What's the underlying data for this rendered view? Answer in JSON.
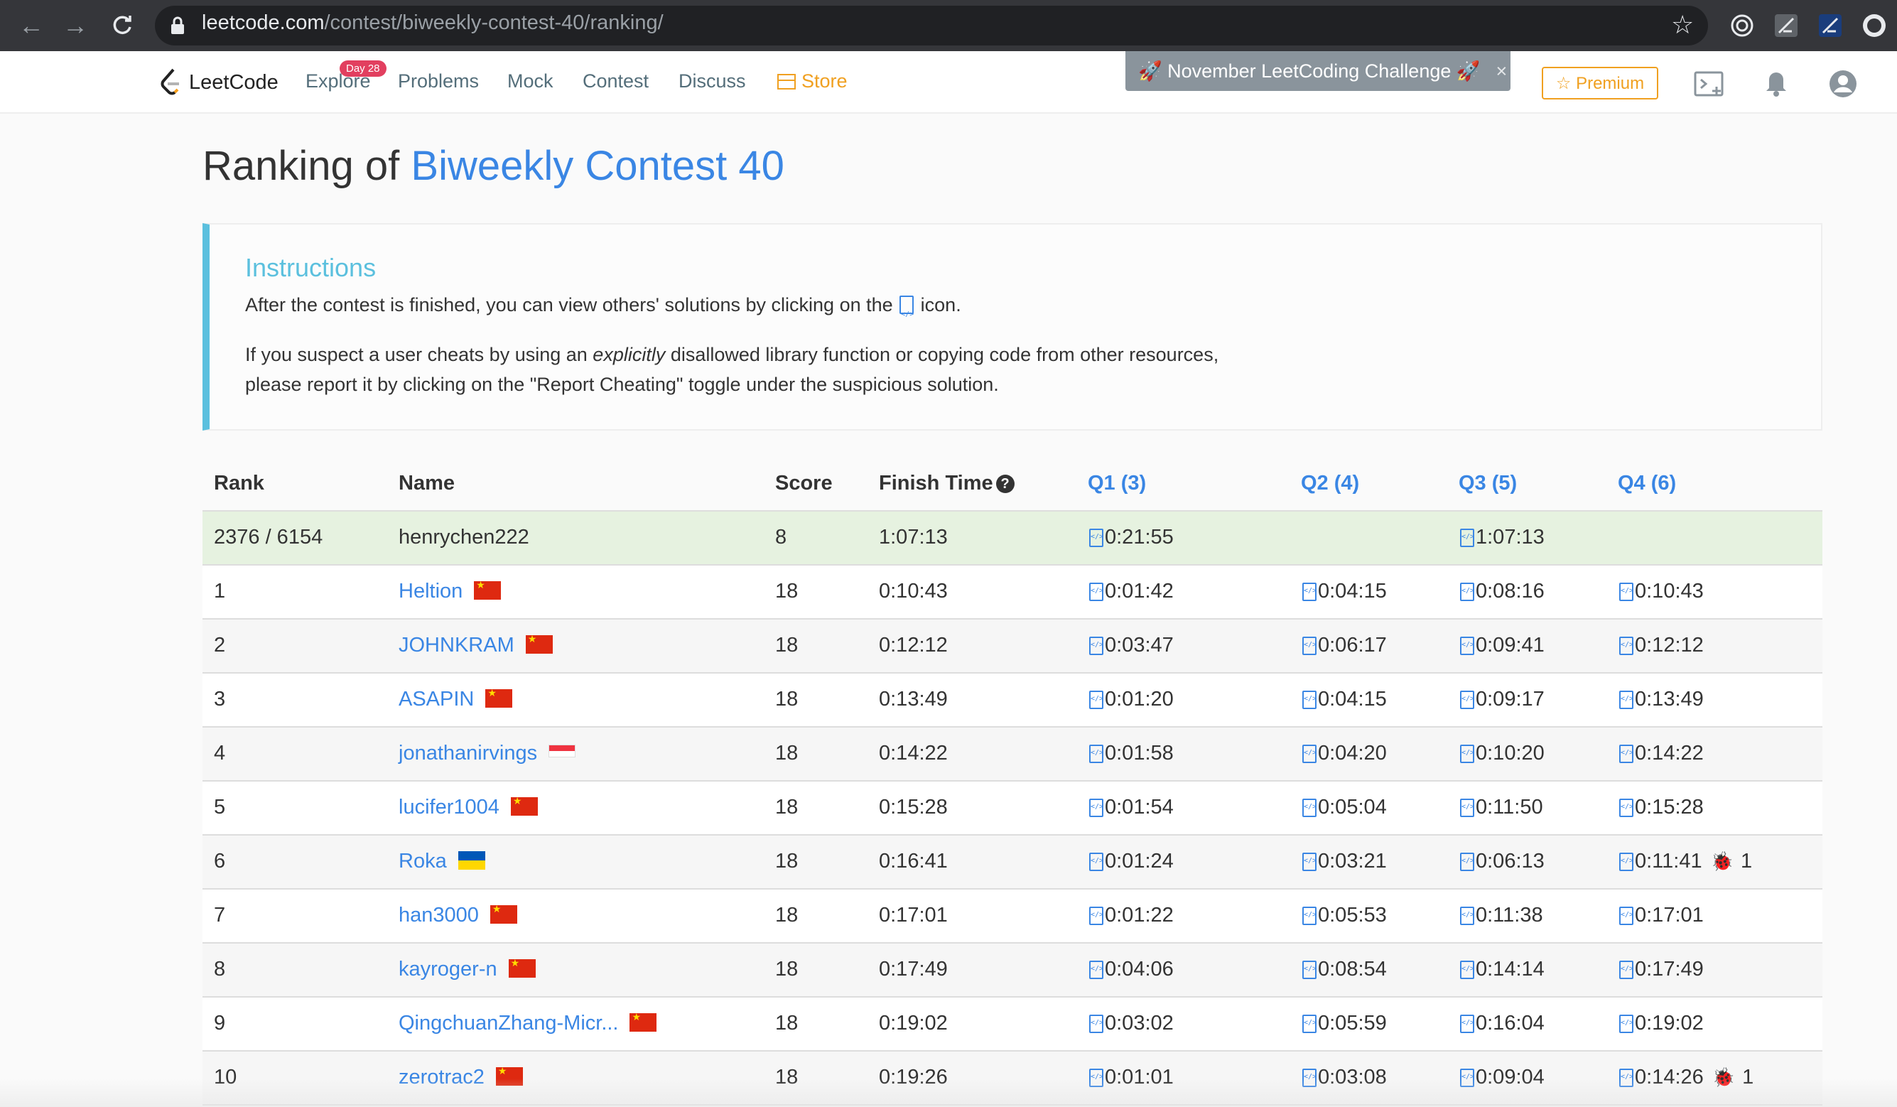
{
  "browser": {
    "url_host": "leetcode.com",
    "url_path": "/contest/biweekly-contest-40/ranking/"
  },
  "nav": {
    "brand": "LeetCode",
    "explore": "Explore",
    "explore_badge": "Day 28",
    "problems": "Problems",
    "mock": "Mock",
    "contest": "Contest",
    "discuss": "Discuss",
    "store": "Store",
    "challenge": "🚀 November LeetCoding Challenge 🚀",
    "challenge_close": "×",
    "premium": "☆ Premium"
  },
  "page": {
    "title_prefix": "Ranking of ",
    "title_contest": "Biweekly Contest 40"
  },
  "instructions": {
    "title": "Instructions",
    "line1_a": "After the contest is finished, you can view others' solutions by clicking on the",
    "line1_b": "icon.",
    "line2_a": "If you suspect a user cheats by using an ",
    "line2_em": "explicitly",
    "line2_b": " disallowed library function or copying code from other resources,",
    "line3": "please report it by clicking on the \"Report Cheating\" toggle under the suspicious solution."
  },
  "table": {
    "headers": {
      "rank": "Rank",
      "name": "Name",
      "score": "Score",
      "finish": "Finish Time",
      "q1": "Q1 (3)",
      "q2": "Q2 (4)",
      "q3": "Q3 (5)",
      "q4": "Q4 (6)"
    },
    "me": {
      "rank": "2376 / 6154",
      "name": "henrychen222",
      "score": "8",
      "finish": "1:07:13",
      "q1": "0:21:55",
      "q2": "",
      "q3": "1:07:13",
      "q4": ""
    },
    "rows": [
      {
        "rank": "1",
        "name": "Heltion",
        "flag": "cn",
        "score": "18",
        "finish": "0:10:43",
        "q1": "0:01:42",
        "q2": "0:04:15",
        "q3": "0:08:16",
        "q4": "0:10:43",
        "q4_bugs": ""
      },
      {
        "rank": "2",
        "name": "JOHNKRAM",
        "flag": "cn",
        "score": "18",
        "finish": "0:12:12",
        "q1": "0:03:47",
        "q2": "0:06:17",
        "q3": "0:09:41",
        "q4": "0:12:12",
        "q4_bugs": ""
      },
      {
        "rank": "3",
        "name": "ASAPIN",
        "flag": "cn",
        "score": "18",
        "finish": "0:13:49",
        "q1": "0:01:20",
        "q2": "0:04:15",
        "q3": "0:09:17",
        "q4": "0:13:49",
        "q4_bugs": ""
      },
      {
        "rank": "4",
        "name": "jonathanirvings",
        "flag": "sg",
        "score": "18",
        "finish": "0:14:22",
        "q1": "0:01:58",
        "q2": "0:04:20",
        "q3": "0:10:20",
        "q4": "0:14:22",
        "q4_bugs": ""
      },
      {
        "rank": "5",
        "name": "lucifer1004",
        "flag": "cn",
        "score": "18",
        "finish": "0:15:28",
        "q1": "0:01:54",
        "q2": "0:05:04",
        "q3": "0:11:50",
        "q4": "0:15:28",
        "q4_bugs": ""
      },
      {
        "rank": "6",
        "name": "Roka",
        "flag": "ua",
        "score": "18",
        "finish": "0:16:41",
        "q1": "0:01:24",
        "q2": "0:03:21",
        "q3": "0:06:13",
        "q4": "0:11:41",
        "q4_bugs": "1"
      },
      {
        "rank": "7",
        "name": "han3000",
        "flag": "cn",
        "score": "18",
        "finish": "0:17:01",
        "q1": "0:01:22",
        "q2": "0:05:53",
        "q3": "0:11:38",
        "q4": "0:17:01",
        "q4_bugs": ""
      },
      {
        "rank": "8",
        "name": "kayroger-n",
        "flag": "cn",
        "score": "18",
        "finish": "0:17:49",
        "q1": "0:04:06",
        "q2": "0:08:54",
        "q3": "0:14:14",
        "q4": "0:17:49",
        "q4_bugs": ""
      },
      {
        "rank": "9",
        "name": "QingchuanZhang-Micr...",
        "flag": "cn",
        "score": "18",
        "finish": "0:19:02",
        "q1": "0:03:02",
        "q2": "0:05:59",
        "q3": "0:16:04",
        "q4": "0:19:02",
        "q4_bugs": ""
      },
      {
        "rank": "10",
        "name": "zerotrac2",
        "flag": "cn",
        "score": "18",
        "finish": "0:19:26",
        "q1": "0:01:01",
        "q2": "0:03:08",
        "q3": "0:09:04",
        "q4": "0:14:26",
        "q4_bugs": "1"
      }
    ]
  }
}
